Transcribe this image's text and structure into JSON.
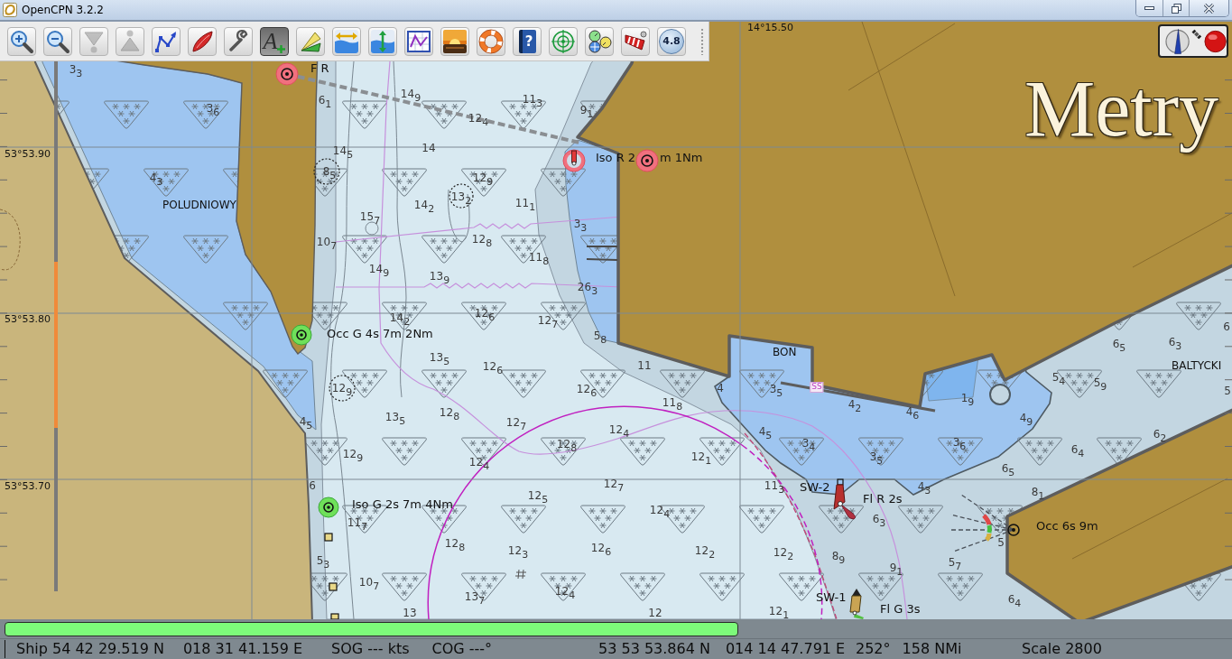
{
  "window": {
    "title": "OpenCPN 3.2.2"
  },
  "toolbar": {
    "buttons": [
      {
        "kind": "zoom-in",
        "selected": false,
        "disabled": false
      },
      {
        "kind": "zoom-out",
        "selected": false,
        "disabled": false
      },
      {
        "kind": "scale-in",
        "selected": false,
        "disabled": true
      },
      {
        "kind": "scale-out",
        "selected": false,
        "disabled": true
      },
      {
        "kind": "route",
        "selected": false,
        "disabled": false
      },
      {
        "kind": "ship",
        "selected": false,
        "disabled": false
      },
      {
        "kind": "settings",
        "selected": false,
        "disabled": false
      },
      {
        "kind": "text",
        "glyph": "A",
        "selected": true,
        "disabled": false
      },
      {
        "kind": "current",
        "selected": false,
        "disabled": false
      },
      {
        "kind": "tide-width",
        "selected": false,
        "disabled": false
      },
      {
        "kind": "tide-height",
        "selected": false,
        "disabled": false
      },
      {
        "kind": "graph",
        "selected": false,
        "disabled": false
      },
      {
        "kind": "sunset",
        "selected": false,
        "disabled": false
      },
      {
        "kind": "lifebuoy",
        "selected": false,
        "disabled": false
      },
      {
        "kind": "help",
        "glyph": "?",
        "selected": false,
        "disabled": false
      },
      {
        "kind": "target",
        "selected": false,
        "disabled": false
      },
      {
        "kind": "gauges",
        "selected": false,
        "disabled": false
      },
      {
        "kind": "banner",
        "selected": false,
        "disabled": false
      },
      {
        "kind": "badge",
        "label": "4.8",
        "selected": false,
        "disabled": false
      }
    ]
  },
  "chart": {
    "units_label": "Metry",
    "longitude_label": "14°15.50",
    "latitude_labels": [
      "53°53.90",
      "53°53.80",
      "53°53.70"
    ],
    "place_names": [
      "POLUDNIOWY",
      "BON",
      "BALTYCKI"
    ],
    "notice_label": "SS",
    "lights": [
      {
        "kind": "port-light",
        "labels": [
          "F R"
        ]
      },
      {
        "kind": "port-beacon",
        "labels": [
          "Iso R 2",
          "m 1Nm"
        ]
      },
      {
        "kind": "port-light"
      },
      {
        "kind": "starboard-light",
        "labels": [
          "Occ G 4s 7m 2Nm"
        ]
      },
      {
        "kind": "starboard-light",
        "labels": [
          "Iso G 2s 7m 4Nm"
        ]
      },
      {
        "kind": "port-buoy",
        "labels": [
          "SW-2",
          "Fl R 2s"
        ]
      },
      {
        "kind": "starboard-buoy",
        "labels": [
          "SW-1",
          "Fl G 3s"
        ]
      },
      {
        "kind": "sector-light",
        "labels": [
          "Occ 6s 9m"
        ]
      }
    ],
    "soundings": [
      "3$_{3}$",
      "6$_{1}$",
      "14$_{9}$",
      "11$_{3}$",
      "3$_{6}$",
      "9$_{1}$",
      "12$_{4}$",
      "14$_{5}$",
      "14",
      "4$_{3}$",
      "8$_{5}$",
      "12$_{9}$",
      "14$_{2}$",
      "13$_{2}$",
      "11$_{1}$",
      "15$_{7}$",
      "3$_{3}$",
      "10$_{7}$",
      "12$_{8}$",
      "11$_{8}$",
      "14$_{9}$",
      "13$_{9}$",
      "26$_{3}$",
      "14$_{2}$",
      "12$_{6}$",
      "12$_{7}$",
      "5$_{8}$",
      "6",
      "6$_{5}$",
      "6$_{3}$",
      "13$_{5}$",
      "12$_{6}$",
      "11",
      "12$_{9}$",
      "12$_{6}$",
      "4",
      "3$_{5}$",
      "5$_{4}$",
      "5$_{9}$",
      "5",
      "11$_{8}$",
      "4$_{2}$",
      "1$_{9}$",
      "4$_{5}$",
      "13$_{5}$",
      "12$_{8}$",
      "12$_{7}$",
      "4$_{6}$",
      "4$_{9}$",
      "12$_{4}$",
      "4$_{5}$",
      "6$_{2}$",
      "12$_{9}$",
      "12$_{4}$",
      "12$_{8}$",
      "12$_{1}$",
      "3$_{4}$",
      "3$_{5}$",
      "3$_{6}$",
      "6$_{5}$",
      "6$_{4}$",
      "6",
      "12$_{5}$",
      "12$_{7}$",
      "11$_{3}$",
      "4$_{3}$",
      "8$_{1}$",
      "12$_{4}$",
      "11$_{7}$",
      "6$_{3}$",
      "5$_{3}$",
      "12$_{8}$",
      "12$_{3}$",
      "12$_{6}$",
      "12$_{2}$",
      "12$_{2}$",
      "8$_{9}$",
      "9$_{1}$",
      "5$_{7}$",
      "5",
      "10$_{7}$",
      "13$_{7}$",
      "12$_{4}$",
      "6$_{4}$",
      "13",
      "12",
      "12$_{1}$"
    ]
  },
  "progress": {
    "level": 0.6
  },
  "status_bar": {
    "fields": [
      {
        "texts": [
          "Ship 54 42 29.519 N",
          "018 31 41.159 E"
        ]
      },
      {
        "texts": [
          "SOG --- kts",
          "COG ---°"
        ]
      },
      {
        "texts": [
          "53 53 53.864 N",
          "014 14 47.791 E"
        ]
      },
      {
        "texts": [
          "252°",
          "158 NMi"
        ]
      },
      {
        "texts": [
          "Scale 2800"
        ]
      }
    ]
  }
}
